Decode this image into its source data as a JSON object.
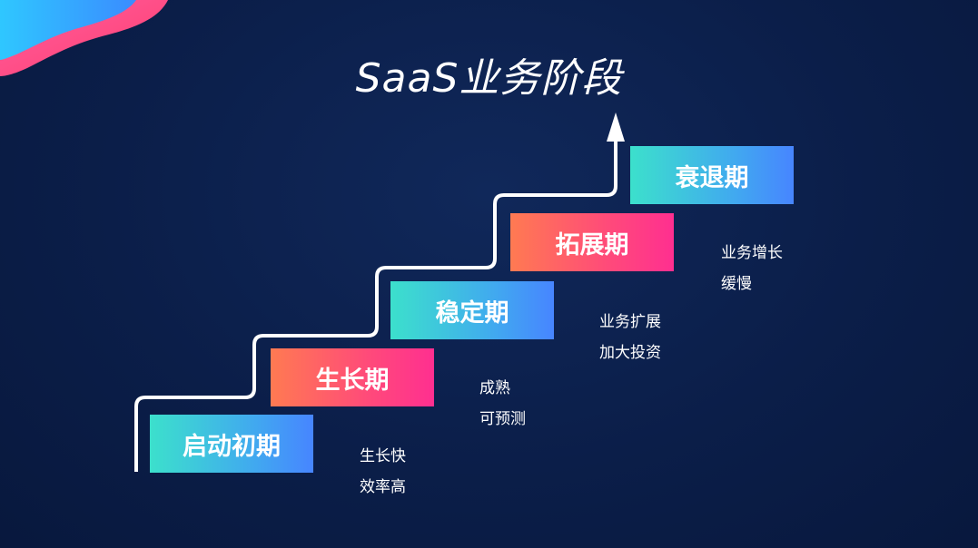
{
  "title": "SaaS业务阶段",
  "stages": [
    {
      "name": "启动初期",
      "desc": [
        "",
        ""
      ],
      "style": "teal"
    },
    {
      "name": "生长期",
      "desc": [
        "生长快",
        "效率高"
      ],
      "style": "pink"
    },
    {
      "name": "稳定期",
      "desc": [
        "成熟",
        "可预测"
      ],
      "style": "teal"
    },
    {
      "name": "拓展期",
      "desc": [
        "业务扩展",
        "加大投资"
      ],
      "style": "pink"
    },
    {
      "name": "衰退期",
      "desc": [
        "业务增长",
        "缓慢"
      ],
      "style": "teal"
    }
  ],
  "colors": {
    "background": "#0b1e49",
    "teal_start": "#3ce0cc",
    "teal_end": "#4785ff",
    "pink_start": "#ff7a52",
    "pink_end": "#ff2f90",
    "line": "#ffffff"
  }
}
